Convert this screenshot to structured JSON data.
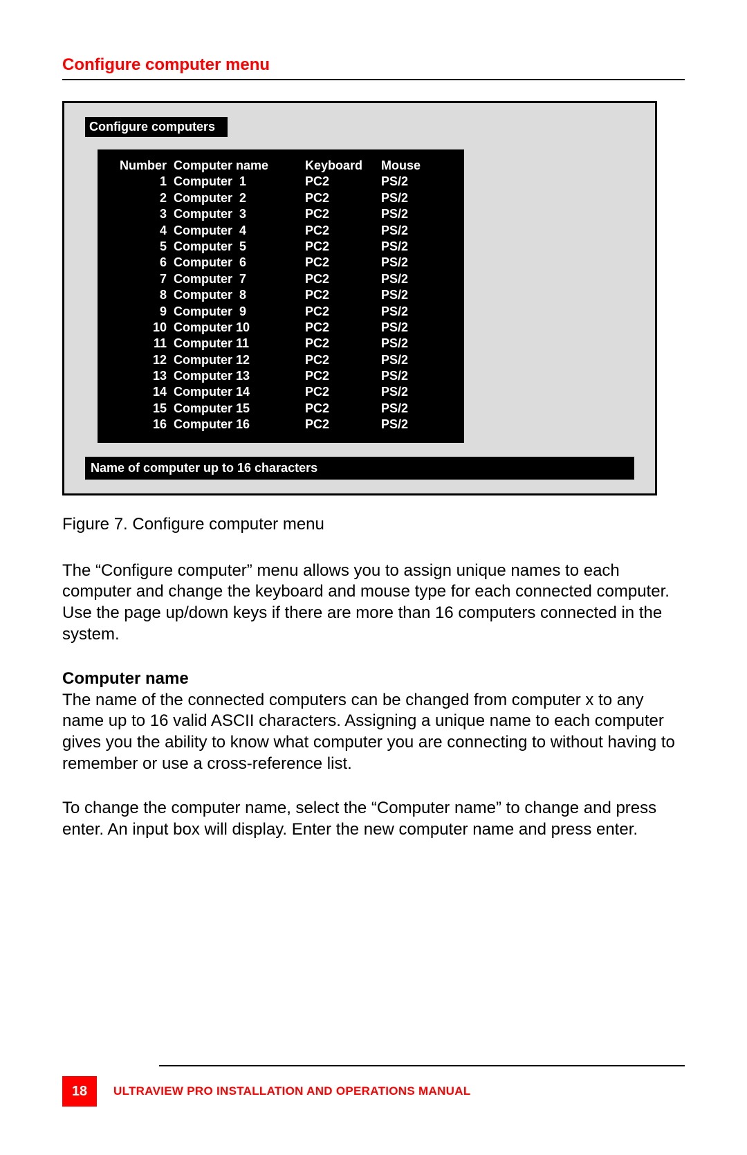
{
  "section_title": "Configure computer menu",
  "figure": {
    "panel_title": "Configure computers",
    "headers": {
      "number": "Number",
      "name": "Computer name",
      "keyboard": "Keyboard",
      "mouse": "Mouse"
    },
    "rows": [
      {
        "num": "1",
        "name": "Computer  1",
        "kbd": "PC2",
        "mouse": "PS/2"
      },
      {
        "num": "2",
        "name": "Computer  2",
        "kbd": "PC2",
        "mouse": "PS/2"
      },
      {
        "num": "3",
        "name": "Computer  3",
        "kbd": "PC2",
        "mouse": "PS/2"
      },
      {
        "num": "4",
        "name": "Computer  4",
        "kbd": "PC2",
        "mouse": "PS/2"
      },
      {
        "num": "5",
        "name": "Computer  5",
        "kbd": "PC2",
        "mouse": "PS/2"
      },
      {
        "num": "6",
        "name": "Computer  6",
        "kbd": "PC2",
        "mouse": "PS/2"
      },
      {
        "num": "7",
        "name": "Computer  7",
        "kbd": "PC2",
        "mouse": "PS/2"
      },
      {
        "num": "8",
        "name": "Computer  8",
        "kbd": "PC2",
        "mouse": "PS/2"
      },
      {
        "num": "9",
        "name": "Computer  9",
        "kbd": "PC2",
        "mouse": "PS/2"
      },
      {
        "num": "10",
        "name": "Computer 10",
        "kbd": "PC2",
        "mouse": "PS/2"
      },
      {
        "num": "11",
        "name": "Computer 11",
        "kbd": "PC2",
        "mouse": "PS/2"
      },
      {
        "num": "12",
        "name": "Computer 12",
        "kbd": "PC2",
        "mouse": "PS/2"
      },
      {
        "num": "13",
        "name": "Computer 13",
        "kbd": "PC2",
        "mouse": "PS/2"
      },
      {
        "num": "14",
        "name": "Computer 14",
        "kbd": "PC2",
        "mouse": "PS/2"
      },
      {
        "num": "15",
        "name": "Computer 15",
        "kbd": "PC2",
        "mouse": "PS/2"
      },
      {
        "num": "16",
        "name": "Computer 16",
        "kbd": "PC2",
        "mouse": "PS/2"
      }
    ],
    "hint": "Name of computer up to 16 characters"
  },
  "caption": "Figure 7. Configure computer menu",
  "para1": "The “Configure computer” menu allows you to assign unique names to each computer and change the keyboard and mouse type for each connected computer. Use the page up/down keys if there are more than 16 computers connected in the system.",
  "subheading": "Computer name",
  "para2": "The name of the connected computers can be changed from computer x to any name up to 16 valid ASCII characters.  Assigning a unique name to each computer gives you the ability to know what computer you are connecting to without having to remember or use a cross-reference list.",
  "para3": "To change the computer name, select the “Computer name” to change and press enter.  An input box will display. Enter the new computer name and press enter.",
  "footer": {
    "page_number": "18",
    "text": "ULTRAVIEW PRO INSTALLATION AND OPERATIONS MANUAL"
  }
}
